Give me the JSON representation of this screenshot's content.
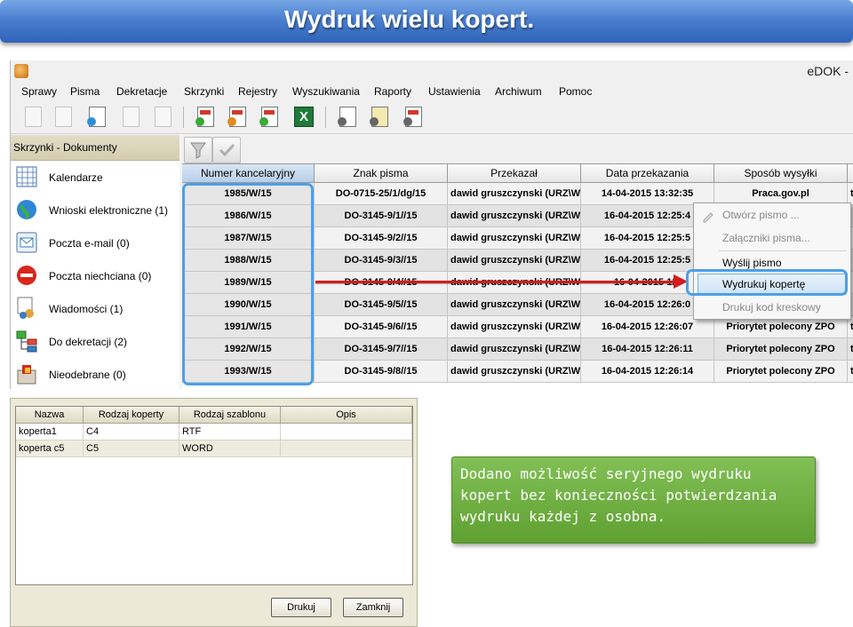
{
  "slide": {
    "title": "Wydruk wielu kopert."
  },
  "app": {
    "name": "eDOK -"
  },
  "menu": [
    {
      "label": "Sprawy"
    },
    {
      "label": "Pisma"
    },
    {
      "label": "Dekretacje"
    },
    {
      "label": "Skrzynki"
    },
    {
      "label": "Rejestry"
    },
    {
      "label": "Wyszukiwania"
    },
    {
      "label": "Raporty"
    },
    {
      "label": "Ustawienia"
    },
    {
      "label": "Archiwum"
    },
    {
      "label": "Pomoc"
    }
  ],
  "toolbar": {
    "icons": [
      "new-page-icon",
      "copy-page-icon",
      "add-page-icon",
      "blank-page-icon",
      "edit-page-icon",
      "report-green-icon",
      "report-orange-icon",
      "report-red-icon",
      "excel-icon",
      "scan-icon",
      "scan-batch-icon",
      "register-icon"
    ]
  },
  "left_panel": {
    "header": "Skrzynki - Dokumenty",
    "items": [
      {
        "label": "Kalendarze",
        "icon": "calendar-icon"
      },
      {
        "label": "Wnioski elektroniczne (1)",
        "icon": "globe-icon"
      },
      {
        "label": "Poczta e-mail (0)",
        "icon": "mail-icon"
      },
      {
        "label": "Poczta niechciana (0)",
        "icon": "no-entry-icon"
      },
      {
        "label": "Wiadomości (1)",
        "icon": "messages-icon"
      },
      {
        "label": "Do dekretacji (2)",
        "icon": "tree-icon"
      },
      {
        "label": "Nieodebrane (0)",
        "icon": "inbox-icon"
      }
    ]
  },
  "grid": {
    "columns": [
      "Numer kancelaryjny",
      "Znak pisma",
      "Przekazał",
      "Data przekazania",
      "Sposób wysyłki",
      ""
    ],
    "rows": [
      [
        "1985/W/15",
        "DO-0715-25/1/dg/15",
        "dawid gruszczynski (URZ\\Wi",
        "14-04-2015 13:32:35",
        "Praca.gov.pl",
        "t"
      ],
      [
        "1986/W/15",
        "DO-3145-9/1//15",
        "dawid gruszczynski (URZ\\Wi",
        "16-04-2015 12:25:4",
        "",
        ""
      ],
      [
        "1987/W/15",
        "DO-3145-9/2//15",
        "dawid gruszczynski (URZ\\Wi",
        "16-04-2015 12:25:5",
        "",
        ""
      ],
      [
        "1988/W/15",
        "DO-3145-9/3//15",
        "dawid gruszczynski (URZ\\Wi",
        "16-04-2015 12:25:5",
        "",
        ""
      ],
      [
        "1989/W/15",
        "DO-3145-9/4//15",
        "dawid gruszczynski (URZ\\Wi",
        "16-04-2015 12:",
        "",
        ""
      ],
      [
        "1990/W/15",
        "DO-3145-9/5//15",
        "dawid gruszczynski (URZ\\Wi",
        "16-04-2015 12:26:0",
        "",
        ""
      ],
      [
        "1991/W/15",
        "DO-3145-9/6//15",
        "dawid gruszczynski (URZ\\Wi",
        "16-04-2015 12:26:07",
        "Priorytet polecony ZPO",
        "t"
      ],
      [
        "1992/W/15",
        "DO-3145-9/7//15",
        "dawid gruszczynski (URZ\\Wi",
        "16-04-2015 12:26:11",
        "Priorytet polecony ZPO",
        "t"
      ],
      [
        "1993/W/15",
        "DO-3145-9/8//15",
        "dawid gruszczynski (URZ\\Wi",
        "16-04-2015 12:26:14",
        "Priorytet polecony ZPO",
        "t"
      ]
    ]
  },
  "context_menu": {
    "items": [
      {
        "label": "Otwórz pismo ..."
      },
      {
        "label": "Załączniki pisma..."
      },
      {
        "label": "Wyślij pismo"
      },
      {
        "label": "Wydrukuj kopertę"
      },
      {
        "label": "Drukuj kod kreskowy"
      }
    ]
  },
  "dialog": {
    "columns": [
      "Nazwa",
      "Rodzaj koperty",
      "Rodzaj szablonu",
      "Opis"
    ],
    "rows": [
      [
        "koperta1",
        "C4",
        "RTF",
        ""
      ],
      [
        "koperta c5",
        "C5",
        "WORD",
        ""
      ]
    ],
    "print_label": "Drukuj",
    "close_label": "Zamknij"
  },
  "callout": {
    "text": "Dodano możliwość seryjnego wydruku kopert bez konieczności potwierdzania wydruku każdej z osobna."
  },
  "colors": {
    "banner": "#3f74c8",
    "highlight": "#4aa0e8",
    "arrow": "#d51b1b",
    "callout": "#6aaa3c"
  }
}
